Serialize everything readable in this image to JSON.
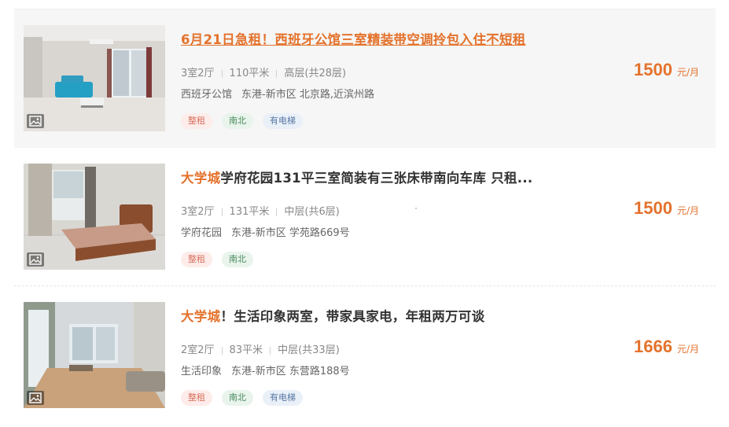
{
  "listings": [
    {
      "title": "6月21日急租！西班牙公馆三室精装带空调拎包入住不短租",
      "title_prefix": "",
      "layout": "3室2厅",
      "area": "110平米",
      "floor": "高层(共28层)",
      "community": "西班牙公馆",
      "district": "东港-新市区",
      "street": "北京路,近滨州路",
      "tags": [
        "整租",
        "南北",
        "有电梯"
      ],
      "price": "1500",
      "unit": "元/月"
    },
    {
      "title": "学府花园131平三室简装有三张床带南向车库 只租...",
      "title_prefix": "大学城",
      "layout": "3室2厅",
      "area": "131平米",
      "floor": "中层(共6层)",
      "community": "学府花园",
      "district": "东港-新市区",
      "street": "学苑路669号",
      "tags": [
        "整租",
        "南北"
      ],
      "price": "1500",
      "unit": "元/月"
    },
    {
      "title": "！生活印象两室，带家具家电，年租两万可谈",
      "title_prefix": "大学城",
      "layout": "2室2厅",
      "area": "83平米",
      "floor": "中层(共33层)",
      "community": "生活印象",
      "district": "东港-新市区",
      "street": "东营路188号",
      "tags": [
        "整租",
        "南北",
        "有电梯"
      ],
      "price": "1666",
      "unit": "元/月"
    }
  ],
  "icons": {
    "gallery": "image-gallery-icon"
  },
  "colors": {
    "accent": "#e4722c",
    "tag_red": "#d9705e",
    "tag_green": "#4a8b5e",
    "tag_blue": "#5777a3"
  }
}
